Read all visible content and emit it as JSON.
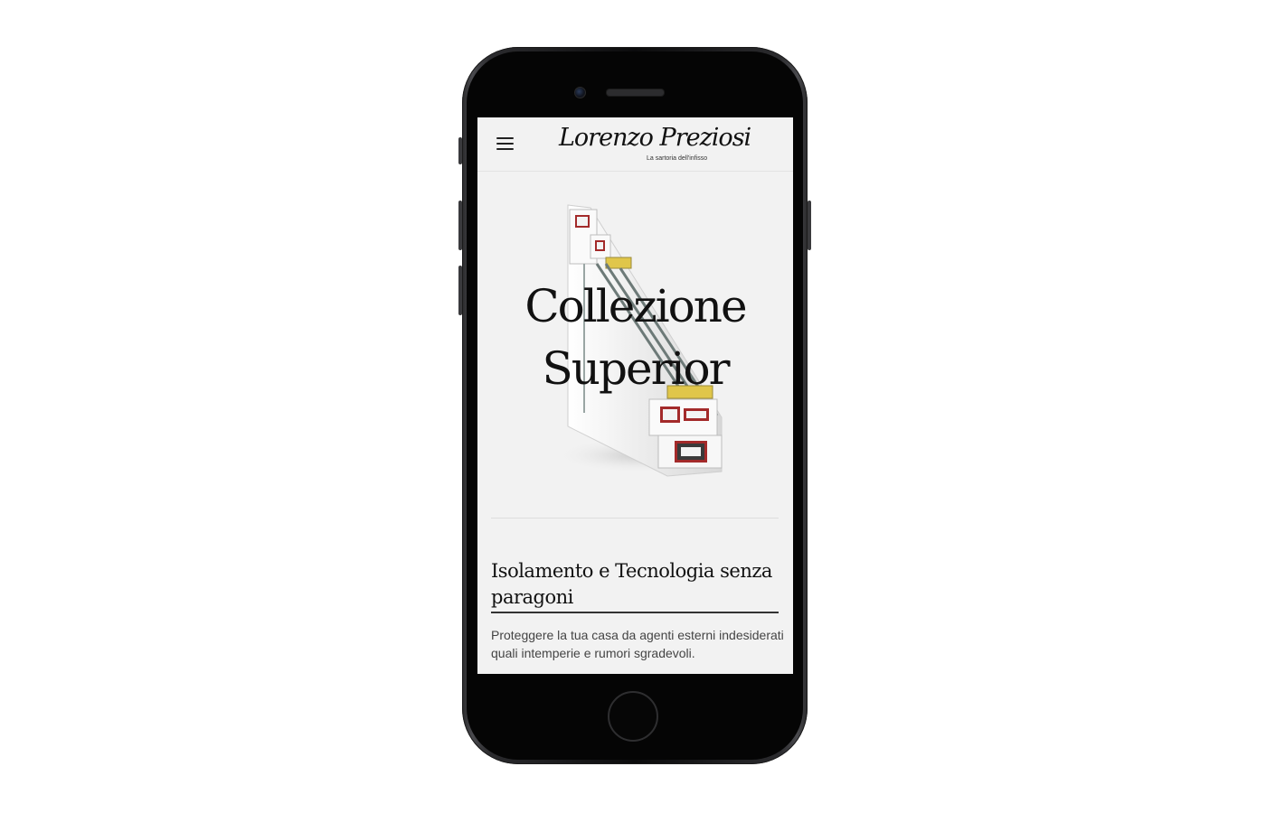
{
  "device": {
    "frame_color": "#2b2b2e",
    "screen_bg": "#f2f2f2"
  },
  "header": {
    "menu_icon": "hamburger-menu-icon",
    "logo_text": "Lorenzo Preziosi",
    "logo_tagline": "La sartoria dell'infisso"
  },
  "hero": {
    "title_line1": "Collezione",
    "title_line2": "Superior",
    "image_name": "window-profile-section"
  },
  "section": {
    "title": "Isolamento e Tecnologia senza paragoni",
    "text": "Proteggere la tua casa da agenti esterni indesiderati quali intemperie e rumori sgradevoli."
  }
}
